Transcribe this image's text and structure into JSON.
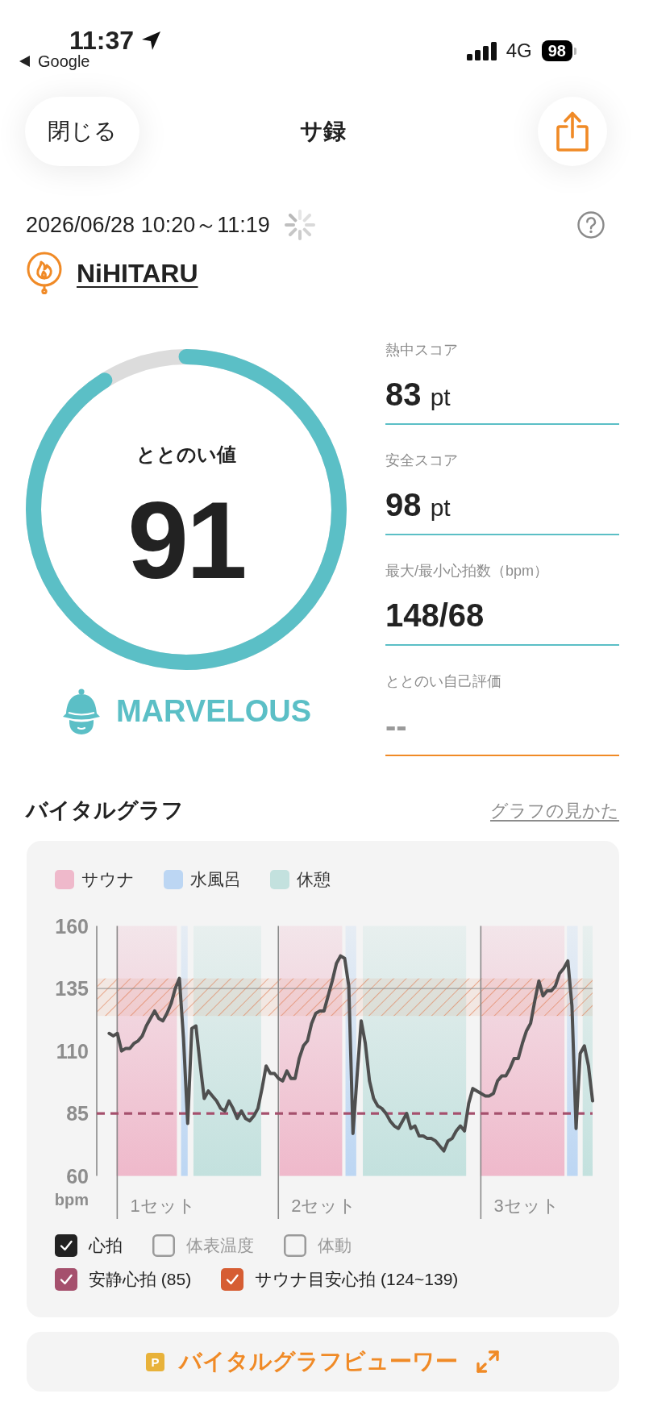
{
  "status_bar": {
    "time": "11:37",
    "back_app": "Google",
    "network": "4G",
    "battery": "98"
  },
  "header": {
    "close_button": "閉じる",
    "title": "サ録"
  },
  "session": {
    "datetime": "2026/06/28 10:20～11:19",
    "facility": "NiHITARU"
  },
  "totonoi": {
    "label": "ととのい値",
    "value": "91",
    "level": 0.91,
    "rank": "MARVELOUS"
  },
  "scores": [
    {
      "kind": "result",
      "label": "熱中スコア",
      "value": "83",
      "unit": "pt"
    },
    {
      "kind": "result",
      "label": "安全スコア",
      "value": "98",
      "unit": "pt"
    },
    {
      "kind": "result",
      "label": "最大/最小心拍数（bpm）",
      "value": "148/68"
    },
    {
      "kind": "rating",
      "label": "ととのい自己評価",
      "placeholder": "--"
    }
  ],
  "vital_graph": {
    "title": "バイタルグラフ",
    "guide_link": "グラフの見かた",
    "legend": [
      {
        "label": "サウナ",
        "color": "#efb9cb"
      },
      {
        "label": "水風呂",
        "color": "#bcd6f3"
      },
      {
        "label": "休憩",
        "color": "#c3e1de"
      }
    ],
    "chart_data": {
      "type": "line",
      "ylabel": "bpm",
      "ylim": [
        60,
        160
      ],
      "yticks": [
        60,
        85,
        110,
        135,
        160
      ],
      "categories": [
        null,
        null,
        null,
        null,
        null,
        null,
        null,
        null,
        null,
        null,
        null,
        null,
        null,
        null,
        null,
        null,
        "1セット",
        null,
        null,
        null,
        null,
        null,
        null,
        null,
        null,
        null,
        null,
        null,
        null,
        null,
        null,
        null,
        null,
        null,
        null,
        null,
        null,
        null,
        null,
        null,
        null,
        null,
        null,
        null,
        null,
        null,
        null,
        null,
        null,
        null,
        null,
        null,
        null,
        null,
        null,
        "2セット",
        null,
        null,
        null,
        null,
        null,
        null,
        null,
        null,
        null,
        null,
        null,
        null,
        null,
        null,
        null,
        null,
        null,
        null,
        null,
        null,
        null,
        null,
        null,
        null,
        null,
        null,
        null,
        null,
        null,
        null,
        null,
        null,
        null,
        null,
        null,
        null,
        null,
        null,
        null,
        null,
        null,
        null,
        null,
        null,
        null,
        null,
        null,
        null,
        "3セット",
        null,
        null,
        null,
        null,
        null,
        null,
        null,
        null,
        null,
        null,
        null,
        null,
        null,
        null,
        null,
        null
      ],
      "series": [
        {
          "color": "#4f4f4f",
          "values": [
            null,
            null,
            null,
            117,
            116,
            117,
            110,
            111,
            111,
            113,
            114,
            116,
            120,
            123,
            126,
            123,
            122,
            125,
            129,
            135,
            139,
            115,
            81,
            119,
            120,
            105,
            91,
            94,
            92,
            90,
            87,
            86,
            90,
            87,
            83,
            86,
            83,
            82,
            84,
            87,
            95,
            104,
            101,
            101,
            99,
            98,
            102,
            99,
            99,
            107,
            112,
            114,
            121,
            125,
            126,
            126,
            132,
            138,
            145,
            148,
            147,
            136,
            77,
            100,
            122,
            113,
            98,
            91,
            88,
            87,
            85,
            82,
            80,
            79,
            82,
            85,
            79,
            80,
            76,
            76,
            75,
            75,
            74,
            72,
            70,
            74,
            75,
            78,
            80,
            78,
            89,
            95,
            94,
            93,
            92,
            92,
            93,
            98,
            100,
            100,
            103,
            107,
            107,
            113,
            118,
            121,
            130,
            138,
            132,
            134,
            134,
            136,
            141,
            143,
            146,
            128,
            79,
            109,
            112,
            104,
            90
          ]
        }
      ],
      "bands": [
        {
          "axis": "y",
          "from": 124,
          "to": 139,
          "color": "#e07445"
        }
      ],
      "ref_lines": [
        {
          "axis": "y",
          "value": 135
        },
        {
          "axis": "y",
          "value": 85,
          "color": "#a5506d"
        }
      ]
    },
    "toggles": [
      {
        "kind": "heart_rate",
        "label": "心拍",
        "checked": true,
        "color": "#222222"
      },
      {
        "kind": "skin_temp",
        "label": "体表温度",
        "checked": false
      },
      {
        "kind": "motion",
        "label": "体動",
        "checked": false
      },
      {
        "kind": "resting",
        "label": "安静心拍 (85)",
        "checked": true,
        "color": "#a5506d"
      },
      {
        "kind": "sauna_target",
        "label": "サウナ目安心拍 (124~139)",
        "checked": true,
        "color": "#d65d33"
      }
    ]
  },
  "viewer_button": {
    "badge": "P",
    "label": "バイタルグラフビューワー"
  }
}
